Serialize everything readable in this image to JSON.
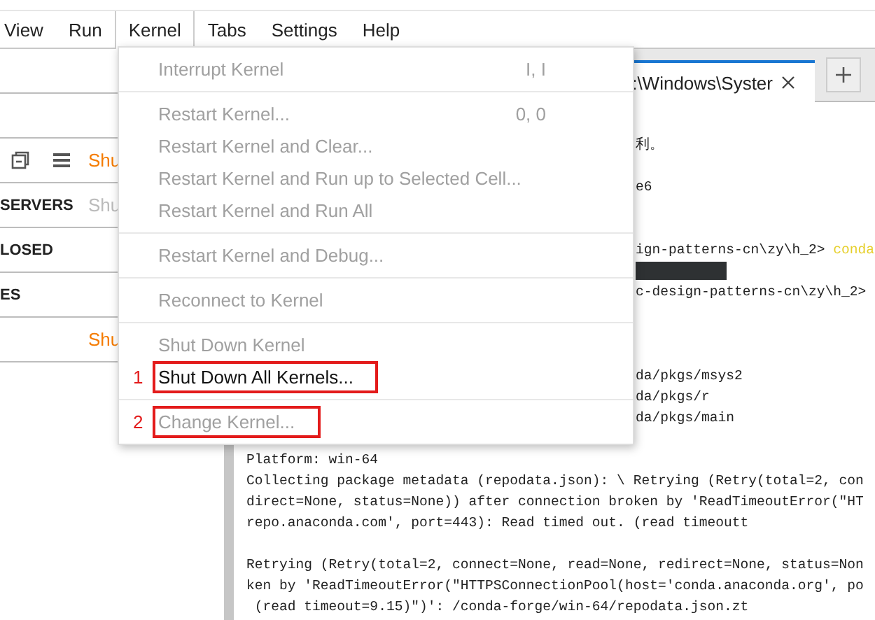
{
  "menu_bar": [
    {
      "label": "View",
      "selected": false
    },
    {
      "label": "Run",
      "selected": false
    },
    {
      "label": "Kernel",
      "selected": true
    },
    {
      "label": "Tabs",
      "selected": false
    },
    {
      "label": "Settings",
      "selected": false
    },
    {
      "label": "Help",
      "selected": false
    }
  ],
  "sidebar": {
    "toolbar_action": "Shu",
    "sections": [
      {
        "title": "SERVERS",
        "action": "Shu"
      },
      {
        "title": "LOSED"
      },
      {
        "title": "ES"
      }
    ],
    "footer_action": "Shu"
  },
  "terminal_tab": {
    "title": ":\\Windows\\Syster",
    "selected": true
  },
  "terminal_lines": [
    {
      "kind": "covered",
      "text": "利。"
    },
    {
      "kind": "blank"
    },
    {
      "kind": "covered",
      "text": "e6"
    },
    {
      "kind": "blank"
    },
    {
      "kind": "blank"
    },
    {
      "kind": "covered",
      "text": "ign-patterns-cn\\zy\\h_2> ",
      "command": "conda"
    },
    {
      "kind": "redacted"
    },
    {
      "kind": "covered",
      "text": "c-design-patterns-cn\\zy\\h_2>"
    },
    {
      "kind": "blank"
    },
    {
      "kind": "blank"
    },
    {
      "kind": "blank"
    },
    {
      "kind": "covered",
      "text": "da/pkgs/msys2"
    },
    {
      "kind": "covered",
      "text": "da/pkgs/r"
    },
    {
      "kind": "covered",
      "text": "da/pkgs/main"
    },
    {
      "kind": "blank"
    },
    {
      "kind": "text",
      "text": "Platform: win-64"
    },
    {
      "kind": "text",
      "text": "Collecting package metadata (repodata.json): \\ Retrying (Retry(total=2, con"
    },
    {
      "kind": "text",
      "text": "direct=None, status=None)) after connection broken by 'ReadTimeoutError(\"HT"
    },
    {
      "kind": "text",
      "text": "repo.anaconda.com', port=443): Read timed out. (read timeoutt"
    },
    {
      "kind": "blank"
    },
    {
      "kind": "text",
      "text": "Retrying (Retry(total=2, connect=None, read=None, redirect=None, status=Non"
    },
    {
      "kind": "text",
      "text": "ken by 'ReadTimeoutError(\"HTTPSConnectionPool(host='conda.anaconda.org', po"
    },
    {
      "kind": "text",
      "text": " (read timeout=9.15)\")': /conda-forge/win-64/repodata.json.zt"
    }
  ],
  "kernel_menu": [
    {
      "kind": "item",
      "label": "Interrupt Kernel",
      "shortcut": "I, I",
      "disabled": true
    },
    {
      "kind": "separator"
    },
    {
      "kind": "item",
      "label": "Restart Kernel...",
      "shortcut": "0, 0",
      "disabled": true
    },
    {
      "kind": "item",
      "label": "Restart Kernel and Clear...",
      "disabled": true
    },
    {
      "kind": "item",
      "label": "Restart Kernel and Run up to Selected Cell...",
      "disabled": true
    },
    {
      "kind": "item",
      "label": "Restart Kernel and Run All",
      "disabled": true
    },
    {
      "kind": "separator"
    },
    {
      "kind": "item",
      "label": "Restart Kernel and Debug...",
      "disabled": true
    },
    {
      "kind": "separator"
    },
    {
      "kind": "item",
      "label": "Reconnect to Kernel",
      "disabled": true
    },
    {
      "kind": "separator"
    },
    {
      "kind": "item",
      "label": "Shut Down Kernel",
      "disabled": true
    },
    {
      "kind": "item",
      "label": "Shut Down All Kernels...",
      "disabled": false,
      "annotation": "1"
    },
    {
      "kind": "separator"
    },
    {
      "kind": "item",
      "label": "Change Kernel...",
      "disabled": true,
      "annotation": "2"
    }
  ]
}
